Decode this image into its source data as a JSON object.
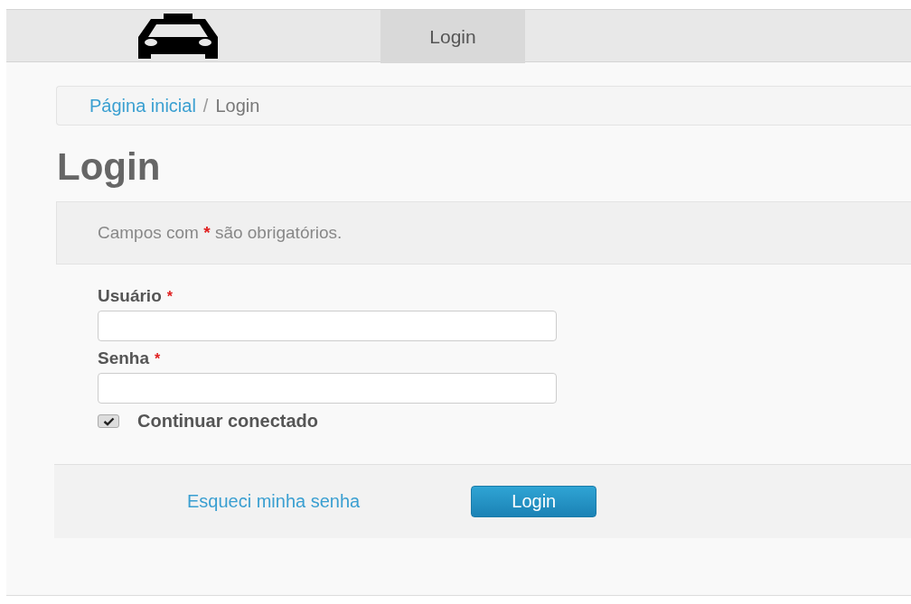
{
  "navbar": {
    "tabs": [
      {
        "label": "Login",
        "selected": true
      }
    ]
  },
  "breadcrumb": [
    {
      "label": "Página inicial",
      "kind": "link"
    },
    {
      "label": "Login",
      "kind": "current"
    }
  ],
  "breadcrumb_separator": "/",
  "heading": "Login",
  "note": {
    "before": "Campos com",
    "mark": "*",
    "after": "são obrigatórios."
  },
  "fields": [
    {
      "label": "Usuário",
      "required_mark": "*"
    },
    {
      "label": "Senha",
      "required_mark": "*"
    }
  ],
  "remember": {
    "label": "Continuar conectado",
    "checked": true
  },
  "footer": {
    "link": "Esqueci minha senha",
    "button": "Login"
  }
}
